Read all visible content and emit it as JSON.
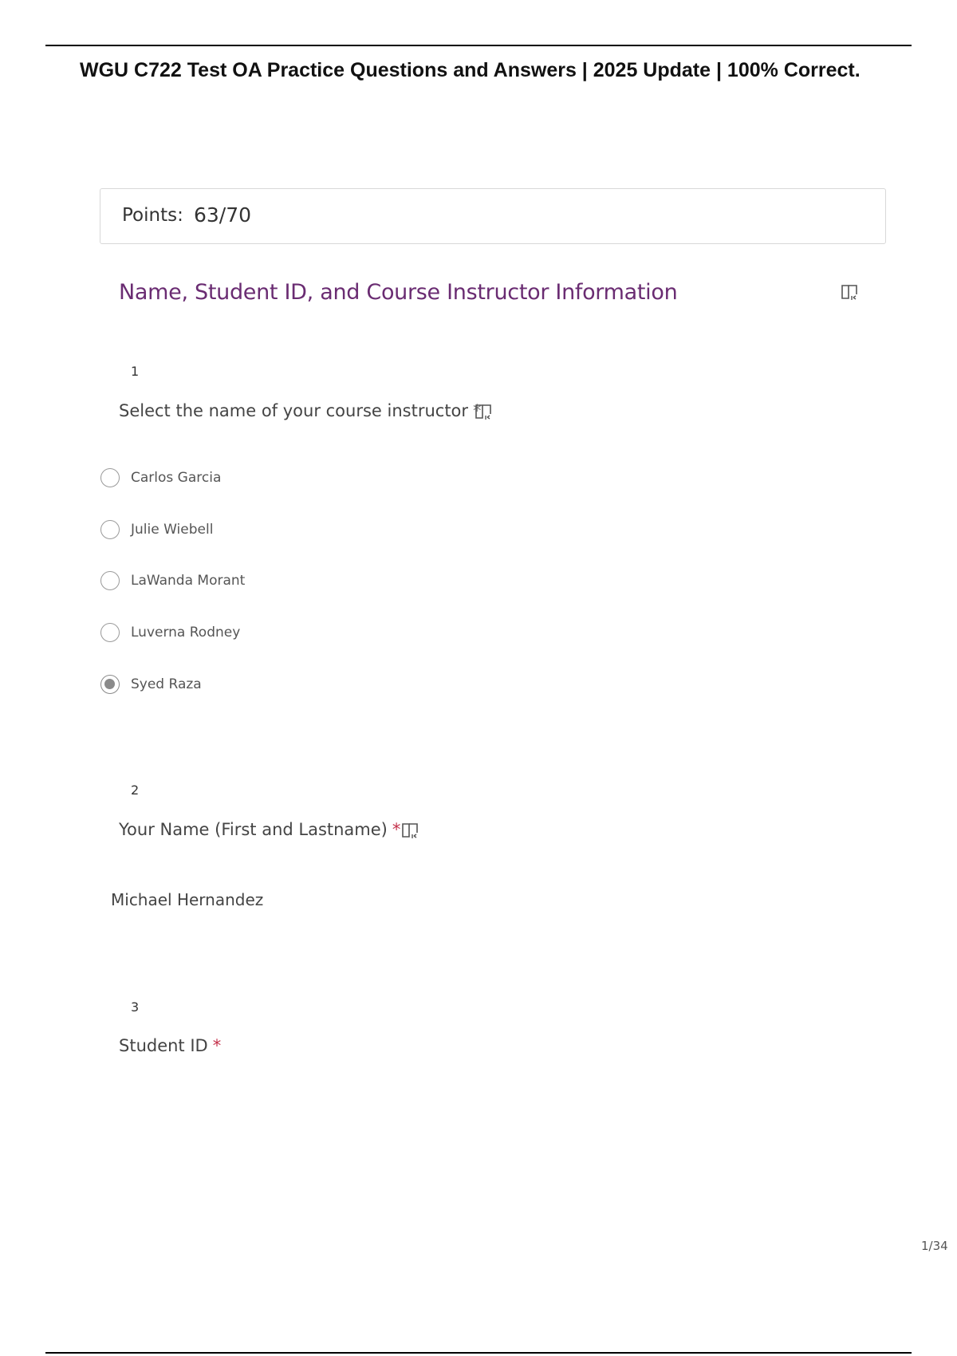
{
  "document": {
    "title": "WGU C722 Test OA Practice Questions and Answers | 2025 Update | 100% Correct.",
    "page_number": "1/34"
  },
  "form": {
    "points_label": "Points:",
    "points_value": "63/70",
    "section_title": "Name, Student ID, and Course Instructor Information",
    "questions": [
      {
        "number": "1",
        "text": "Select the name of your course instructor",
        "required_mark": "*",
        "options": [
          {
            "label": "Carlos Garcia",
            "selected": false
          },
          {
            "label": "Julie Wiebell",
            "selected": false
          },
          {
            "label": "LaWanda Morant",
            "selected": false
          },
          {
            "label": "Luverna Rodney",
            "selected": false
          },
          {
            "label": "Syed Raza",
            "selected": true
          }
        ]
      },
      {
        "number": "2",
        "text": "Your Name (First and Lastname)",
        "required_mark": "*",
        "answer": "Michael Hernandez"
      },
      {
        "number": "3",
        "text": "Student ID",
        "required_mark": "*"
      }
    ]
  },
  "icons": {
    "immersive_reader": "immersive-reader-icon"
  },
  "colors": {
    "section_title": "#6a2c72",
    "required_star": "#c4314b"
  }
}
